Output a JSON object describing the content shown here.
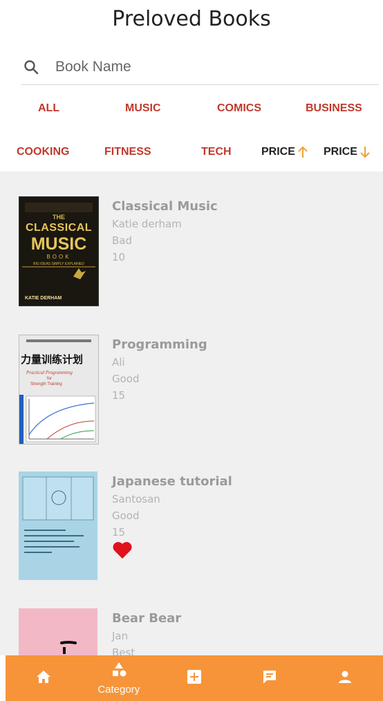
{
  "header": {
    "title": "Preloved Books"
  },
  "search": {
    "placeholder": "Book Name"
  },
  "categories": [
    "ALL",
    "MUSIC",
    "COMICS",
    "BUSINESS",
    "COOKING",
    "FITNESS",
    "TECH"
  ],
  "sort": {
    "asc_label": "PRICE",
    "desc_label": "PRICE",
    "accent_color": "#f0a030"
  },
  "books": [
    {
      "title": "Classical Music",
      "author": "Katie derham",
      "condition": "Bad",
      "price": "10",
      "cover": {
        "brand": "THE",
        "line1": "CLASSICAL",
        "line2": "MUSIC",
        "line3": "BOOK",
        "tagline": "BIG IDEAS SIMPLY EXPLAINED",
        "author": "KATIE DERHAM"
      },
      "favorite": false
    },
    {
      "title": "Programming",
      "author": "Ali",
      "condition": "Good",
      "price": "15",
      "cover": {
        "heading": "力量训练计划",
        "sub1": "Practical Programming",
        "sub2": "for",
        "sub3": "Strength Training"
      },
      "favorite": false
    },
    {
      "title": "Japanese tutorial",
      "author": "Santosan",
      "condition": "Good",
      "price": "15",
      "favorite": true
    },
    {
      "title": "Bear Bear",
      "author": "Jan",
      "condition": "Best",
      "price": "",
      "favorite": false
    }
  ],
  "nav": {
    "category_label": "Category"
  },
  "colors": {
    "accent": "#f7943a",
    "category_text": "#c0392b",
    "favorite": "#e0121b"
  }
}
